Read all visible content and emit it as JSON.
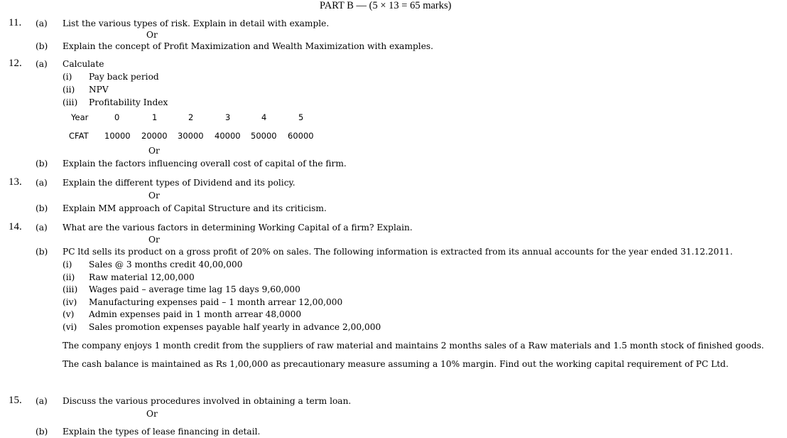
{
  "header": "PART B — (5 × 13 = 65 marks)",
  "q11": {
    "num": "11.",
    "a_label": "(a)",
    "a_text": "List the various types of risk. Explain in detail with example.",
    "or": "Or",
    "b_label": "(b)",
    "b_text": "Explain the concept of Profit Maximization and Wealth Maximization with examples."
  },
  "q12": {
    "num": "12.",
    "a_label": "(a)",
    "a_text": "Calculate",
    "items": [
      {
        "roman": "(i)",
        "text": "Pay back period"
      },
      {
        "roman": "(ii)",
        "text": "NPV"
      },
      {
        "roman": "(iii)",
        "text": "Profitability Index"
      }
    ],
    "table": {
      "year_label": "Year",
      "years": [
        "0",
        "1",
        "2",
        "3",
        "4",
        "5"
      ],
      "cfat_label": "CFAT",
      "cfat": [
        "10000",
        "20000",
        "30000",
        "40000",
        "50000",
        "60000"
      ]
    },
    "or": "Or",
    "b_label": "(b)",
    "b_text": "Explain the factors influencing overall cost of capital of the firm."
  },
  "q13": {
    "num": "13.",
    "a_label": "(a)",
    "a_text": "Explain the different types of Dividend and its policy.",
    "or": "Or",
    "b_label": "(b)",
    "b_text": "Explain MM approach of Capital Structure and its criticism."
  },
  "q14": {
    "num": "14.",
    "a_label": "(a)",
    "a_text": "What are the various factors in determining Working Capital of a firm? Explain.",
    "or": "Or",
    "b_label": "(b)",
    "b_text": "PC ltd sells its product on a gross profit of 20% on sales. The following information is extracted from its annual accounts for the year ended 31.12.2011.",
    "items": [
      {
        "roman": "(i)",
        "text": "Sales @ 3 months credit 40,00,000"
      },
      {
        "roman": "(ii)",
        "text": "Raw material 12,00,000"
      },
      {
        "roman": "(iii)",
        "text": "Wages paid – average time lag 15 days 9,60,000"
      },
      {
        "roman": "(iv)",
        "text": "Manufacturing expenses paid – 1 month arrear 12,00,000"
      },
      {
        "roman": "(v)",
        "text": "Admin expenses paid in 1 month arrear 48,0000"
      },
      {
        "roman": "(vi)",
        "text": "Sales promotion expenses payable half yearly in advance 2,00,000"
      }
    ],
    "para1": "The company enjoys 1 month credit from the suppliers of raw material and maintains 2 months sales of a Raw materials and 1.5 month stock of finished goods.",
    "para2": "The cash balance is maintained as Rs 1,00,000 as precautionary measure assuming a 10% margin. Find out the working capital requirement of PC Ltd."
  },
  "q15": {
    "num": "15.",
    "a_label": "(a)",
    "a_text": "Discuss the various procedures involved in obtaining a term loan.",
    "or": "Or",
    "b_label": "(b)",
    "b_text": "Explain the types of lease financing in detail."
  }
}
